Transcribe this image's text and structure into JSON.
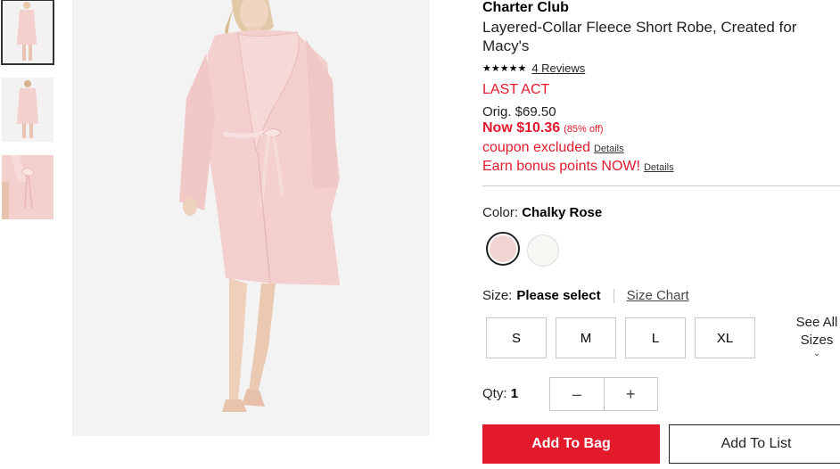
{
  "product": {
    "brand": "Charter Club",
    "title": "Layered-Collar Fleece Short Robe, Created for Macy's",
    "stars": "★★★★★",
    "reviews_label": "4 Reviews",
    "badge": "LAST ACT",
    "orig_price": "Orig. $69.50",
    "now_price": "Now $10.36",
    "discount": "(85% off)",
    "coupon_text": "coupon excluded",
    "coupon_details": "Details",
    "bonus_text": "Earn bonus points NOW!",
    "bonus_details": "Details"
  },
  "color": {
    "label": "Color:",
    "selected": "Chalky Rose",
    "swatches": [
      {
        "name": "Chalky Rose",
        "hex": "#f1d4d2"
      },
      {
        "name": "White",
        "hex": "#f8f7f4"
      }
    ]
  },
  "size": {
    "label": "Size:",
    "selected": "Please select",
    "chart_link": "Size Chart",
    "options": [
      "S",
      "M",
      "L",
      "XL"
    ],
    "see_all": "See All Sizes"
  },
  "quantity": {
    "label": "Qty:",
    "value": "1",
    "minus": "–",
    "plus": "+"
  },
  "actions": {
    "add_to_bag": "Add To Bag",
    "add_to_list": "Add To List"
  },
  "colors": {
    "accent": "#e21a2c",
    "robe": "#f3cfcd"
  }
}
